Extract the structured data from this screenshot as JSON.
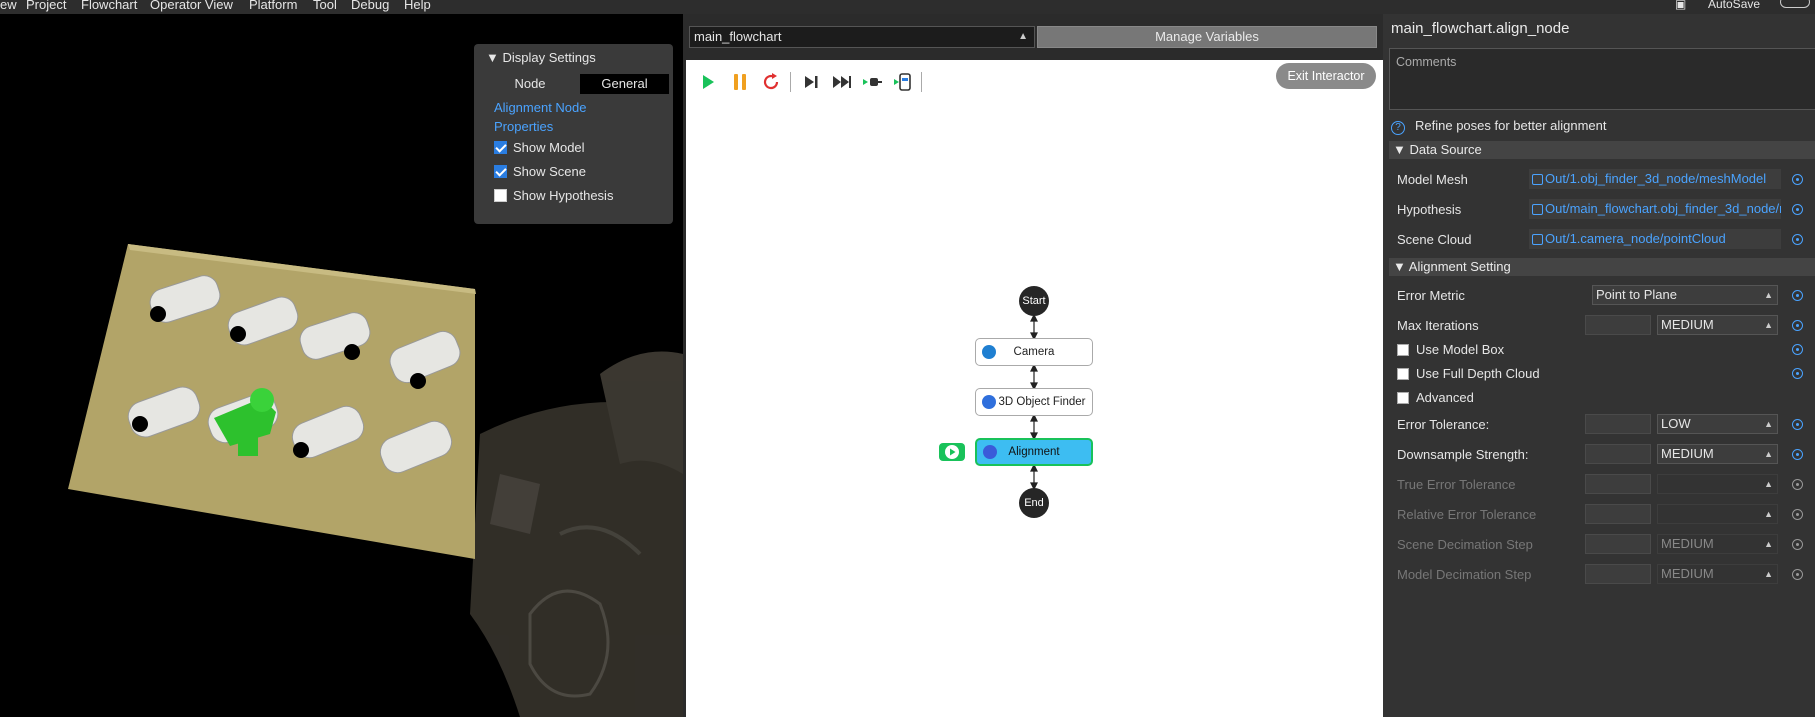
{
  "menubar": {
    "items": [
      "ew",
      "Project",
      "Flowchart",
      "Operator View",
      "Platform",
      "Tool",
      "Debug",
      "Help"
    ],
    "autosave_label": "AutoSave"
  },
  "display_settings": {
    "title": "Display Settings",
    "tabs": [
      "Node",
      "General"
    ],
    "link": "Alignment Node Properties",
    "checks": [
      {
        "label": "Show Model",
        "checked": true
      },
      {
        "label": "Show Scene",
        "checked": true
      },
      {
        "label": "Show Hypothesis",
        "checked": false
      }
    ]
  },
  "flowchart": {
    "selected": "main_flowchart",
    "manage_variables": "Manage Variables",
    "exit_interactor": "Exit Interactor",
    "nodes": {
      "start": "Start",
      "camera": "Camera",
      "finder": "3D Object Finder",
      "alignment": "Alignment",
      "end": "End"
    }
  },
  "properties": {
    "title": "main_flowchart.align_node",
    "comments_placeholder": "Comments",
    "description": "Refine poses for better alignment",
    "data_source": {
      "header": "Data Source",
      "rows": [
        {
          "label": "Model Mesh",
          "value": "Out/1.obj_finder_3d_node/meshModel"
        },
        {
          "label": "Hypothesis",
          "value": "Out/main_flowchart.obj_finder_3d_node/r"
        },
        {
          "label": "Scene Cloud",
          "value": "Out/1.camera_node/pointCloud"
        }
      ]
    },
    "alignment": {
      "header": "Alignment Setting",
      "error_metric_label": "Error Metric",
      "error_metric_value": "Point to Plane",
      "max_iterations_label": "Max Iterations",
      "max_iterations_value": "MEDIUM",
      "use_model_box": "Use Model Box",
      "use_full_depth": "Use Full Depth Cloud",
      "advanced": "Advanced",
      "error_tolerance_label": "Error Tolerance:",
      "error_tolerance_value": "LOW",
      "downsample_label": "Downsample Strength:",
      "downsample_value": "MEDIUM",
      "true_error_label": "True Error Tolerance",
      "relative_error_label": "Relative Error Tolerance",
      "scene_decimation_label": "Scene Decimation Step",
      "scene_decimation_value": "MEDIUM",
      "model_decimation_label": "Model Decimation Step",
      "model_decimation_value": "MEDIUM"
    }
  },
  "colors": {
    "accent_blue": "#4aa3ff",
    "run_green": "#19c25a",
    "alignment_node": "#3dbdf2"
  }
}
